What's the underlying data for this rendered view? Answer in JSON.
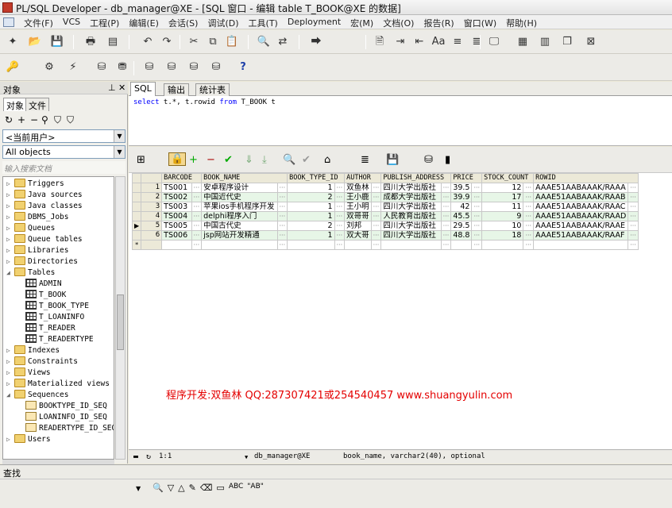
{
  "window": {
    "title": "PL/SQL Developer - db_manager@XE - [SQL 窗口 - 编辑 table T_BOOK@XE 的数据]"
  },
  "menu": [
    "文件(F)",
    "VCS",
    "工程(P)",
    "编辑(E)",
    "会话(S)",
    "调试(D)",
    "工具(T)",
    "Deployment",
    "宏(M)",
    "文档(O)",
    "报告(R)",
    "窗口(W)",
    "帮助(H)"
  ],
  "left_panel": {
    "title": "对象",
    "pin_icon": "pin-icon",
    "close_icon": "close-icon",
    "tabs": [
      "对象",
      "文件"
    ],
    "user_combo": "<当前用户>",
    "filter_combo": "All objects",
    "search_placeholder": "输入搜索文档",
    "tree": [
      {
        "label": "Triggers",
        "level": 0,
        "expanded": false,
        "icon": "folder"
      },
      {
        "label": "Java sources",
        "level": 0,
        "expanded": false,
        "icon": "folder"
      },
      {
        "label": "Java classes",
        "level": 0,
        "expanded": false,
        "icon": "folder"
      },
      {
        "label": "DBMS_Jobs",
        "level": 0,
        "expanded": false,
        "icon": "folder"
      },
      {
        "label": "Queues",
        "level": 0,
        "expanded": false,
        "icon": "folder"
      },
      {
        "label": "Queue tables",
        "level": 0,
        "expanded": false,
        "icon": "folder"
      },
      {
        "label": "Libraries",
        "level": 0,
        "expanded": false,
        "icon": "folder"
      },
      {
        "label": "Directories",
        "level": 0,
        "expanded": false,
        "icon": "folder"
      },
      {
        "label": "Tables",
        "level": 0,
        "expanded": true,
        "icon": "folder"
      },
      {
        "label": "ADMIN",
        "level": 1,
        "icon": "table"
      },
      {
        "label": "T_BOOK",
        "level": 1,
        "icon": "table"
      },
      {
        "label": "T_BOOK_TYPE",
        "level": 1,
        "icon": "table"
      },
      {
        "label": "T_LOANINFO",
        "level": 1,
        "icon": "table"
      },
      {
        "label": "T_READER",
        "level": 1,
        "icon": "table"
      },
      {
        "label": "T_READERTYPE",
        "level": 1,
        "icon": "table"
      },
      {
        "label": "Indexes",
        "level": 0,
        "expanded": false,
        "icon": "folder"
      },
      {
        "label": "Constraints",
        "level": 0,
        "expanded": false,
        "icon": "folder"
      },
      {
        "label": "Views",
        "level": 0,
        "expanded": false,
        "icon": "folder"
      },
      {
        "label": "Materialized views",
        "level": 0,
        "expanded": false,
        "icon": "folder"
      },
      {
        "label": "Sequences",
        "level": 0,
        "expanded": true,
        "icon": "folder"
      },
      {
        "label": "BOOKTYPE_ID_SEQ",
        "level": 1,
        "icon": "seq"
      },
      {
        "label": "LOANINFO_ID_SEQ",
        "level": 1,
        "icon": "seq"
      },
      {
        "label": "READERTYPE_ID_SEQ",
        "level": 1,
        "icon": "seq"
      },
      {
        "label": "Users",
        "level": 0,
        "expanded": false,
        "icon": "folder"
      }
    ]
  },
  "editor": {
    "tabs": [
      "SQL",
      "输出",
      "统计表"
    ],
    "sql_keyword_select": "select",
    "sql_middle": " t.*, t.rowid ",
    "sql_keyword_from": "from",
    "sql_tail": " T_BOOK t"
  },
  "grid": {
    "columns": [
      "BARCODE",
      "BOOK_NAME",
      "BOOK_TYPE_ID",
      "AUTHOR",
      "PUBLISH_ADDRESS",
      "PRICE",
      "STOCK_COUNT",
      "ROWID"
    ],
    "rows": [
      {
        "n": "1",
        "barcode": "TS001",
        "book_name": "安卓程序设计",
        "type_id": "1",
        "author": "双鱼林",
        "publish": "四川大学出版社",
        "price": "39.5",
        "stock": "12",
        "rowid": "AAAE51AABAAAK/RAAA"
      },
      {
        "n": "2",
        "barcode": "TS002",
        "book_name": "中国近代史",
        "type_id": "2",
        "author": "王小鹿",
        "publish": "成都大学出版社",
        "price": "39.9",
        "stock": "17",
        "rowid": "AAAE51AABAAAK/RAAB"
      },
      {
        "n": "3",
        "barcode": "TS003",
        "book_name": "苹果ios手机程序开发",
        "type_id": "1",
        "author": "王小明",
        "publish": "四川大学出版社",
        "price": "42",
        "stock": "11",
        "rowid": "AAAE51AABAAAK/RAAC"
      },
      {
        "n": "4",
        "barcode": "TS004",
        "book_name": "delphi程序入门",
        "type_id": "1",
        "author": "双哥哥",
        "publish": "人民教育出版社",
        "price": "45.5",
        "stock": "9",
        "rowid": "AAAE51AABAAAK/RAAD"
      },
      {
        "n": "5",
        "barcode": "TS005",
        "book_name": "中国古代史",
        "type_id": "2",
        "author": "刘邦",
        "publish": "四川大学出版社",
        "price": "29.5",
        "stock": "10",
        "rowid": "AAAE51AABAAAK/RAAE"
      },
      {
        "n": "6",
        "barcode": "TS006",
        "book_name": "jsp网站开发精通",
        "type_id": "1",
        "author": "双大哥",
        "publish": "四川大学出版社",
        "price": "48.8",
        "stock": "18",
        "rowid": "AAAE51AABAAAK/RAAF"
      }
    ],
    "current_row_marker": "▶",
    "new_row_marker": "*",
    "cell_dots": "···",
    "overlay_text": "程序开发:双鱼林 QQ:287307421或254540457 www.shuangyulin.com"
  },
  "statusbar": {
    "position": "1:1",
    "connection": "db_manager@XE",
    "column_info": "book_name, varchar2(40), optional"
  },
  "find": {
    "label": "查找",
    "ab_text": "ABC",
    "ab2_text": "\"AB\""
  },
  "colors": {
    "row_alt": "#e7f6e7",
    "overlay": "#e40000",
    "sql_keyword": "#0000ff"
  }
}
